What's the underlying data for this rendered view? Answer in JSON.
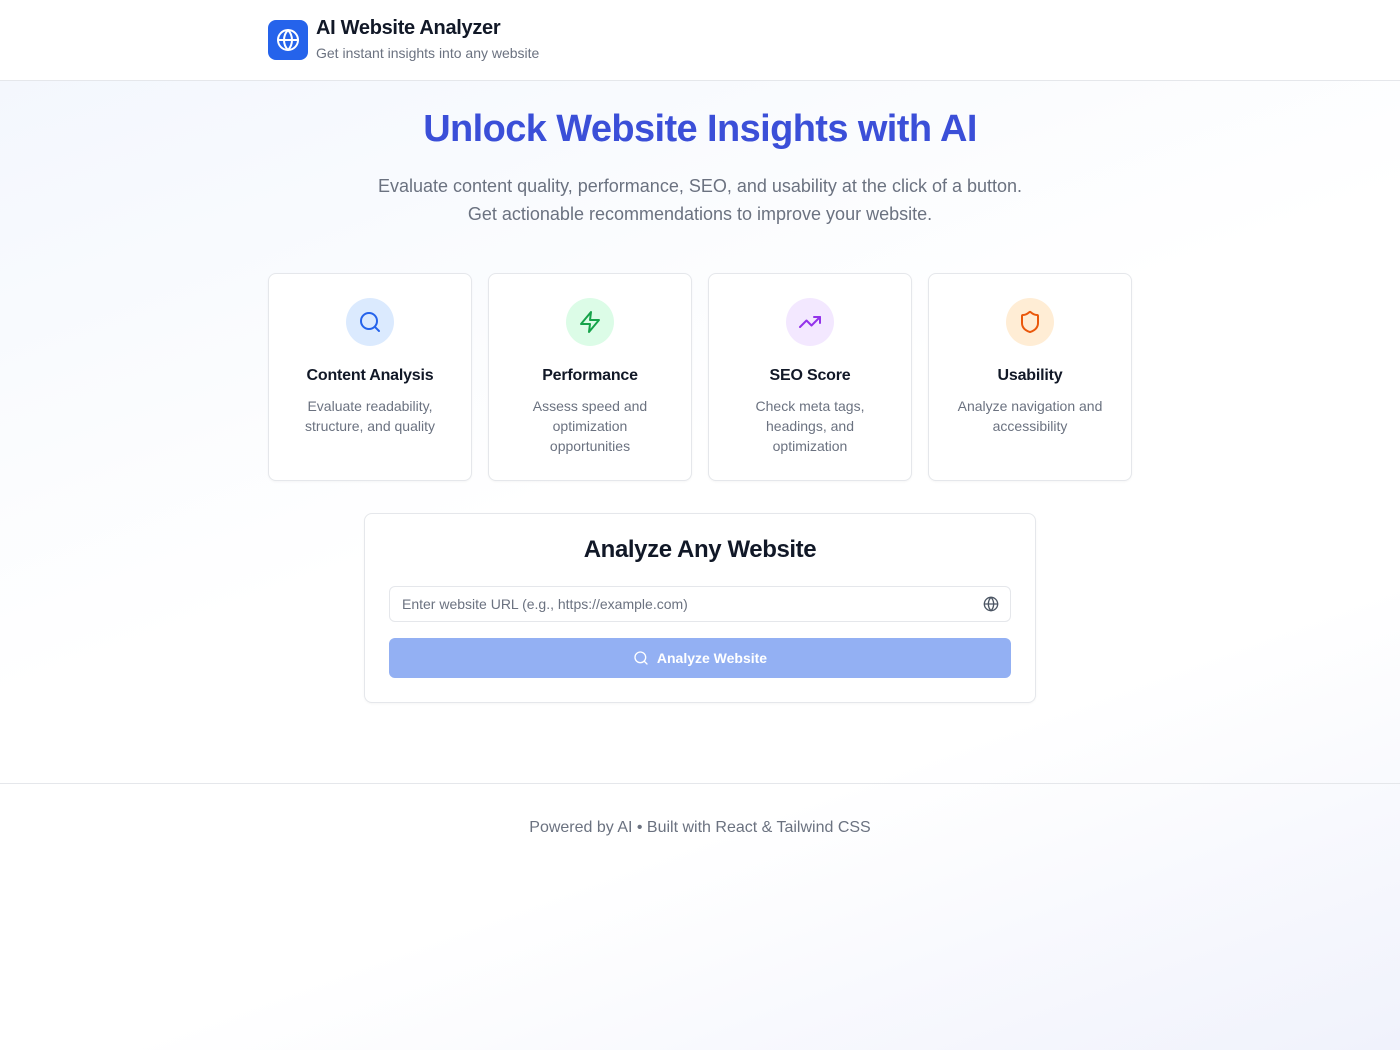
{
  "header": {
    "app_title": "AI Website Analyzer",
    "app_subtitle": "Get instant insights into any website",
    "logo_icon": "globe-icon",
    "logo_color": "#2563eb"
  },
  "hero": {
    "title": "Unlock Website Insights with AI",
    "description_line1": "Evaluate content quality, performance, SEO, and usability at the click of a button.",
    "description_line2": "Get actionable recommendations to improve your website.",
    "title_color": "#3b4fd8"
  },
  "features": [
    {
      "title": "Content Analysis",
      "description": "Evaluate readability, structure, and quality",
      "icon": "search-icon",
      "icon_bg": "#dbeafe",
      "icon_color": "#2563eb"
    },
    {
      "title": "Performance",
      "description": "Assess speed and optimization opportunities",
      "icon": "lightning-icon",
      "icon_bg": "#dcfce7",
      "icon_color": "#16a34a"
    },
    {
      "title": "SEO Score",
      "description": "Check meta tags, headings, and optimization",
      "icon": "trending-up-icon",
      "icon_bg": "#f3e8ff",
      "icon_color": "#9333ea"
    },
    {
      "title": "Usability",
      "description": "Analyze navigation and accessibility",
      "icon": "shield-icon",
      "icon_bg": "#ffedd5",
      "icon_color": "#ea580c"
    }
  ],
  "analyzer": {
    "title": "Analyze Any Website",
    "url_placeholder": "Enter website URL (e.g., https://example.com)",
    "url_value": "",
    "button_label": "Analyze Website",
    "button_color": "#93b0f3"
  },
  "footer": {
    "text": "Powered by AI • Built with React & Tailwind CSS"
  }
}
